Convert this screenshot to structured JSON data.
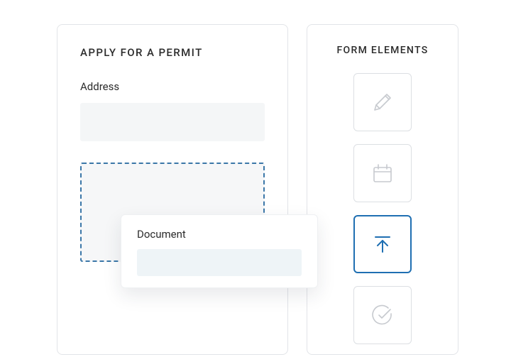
{
  "form": {
    "title": "APPLY FOR A PERMIT",
    "address_label": "Address",
    "address_value": ""
  },
  "drag_card": {
    "label": "Document"
  },
  "palette": {
    "title": "FORM ELEMENTS",
    "items": [
      {
        "name": "pencil",
        "selected": false
      },
      {
        "name": "calendar",
        "selected": false
      },
      {
        "name": "upload",
        "selected": true
      },
      {
        "name": "check-circle",
        "selected": false
      }
    ]
  },
  "colors": {
    "accent": "#1f6fb2",
    "muted": "#c7cacf"
  }
}
